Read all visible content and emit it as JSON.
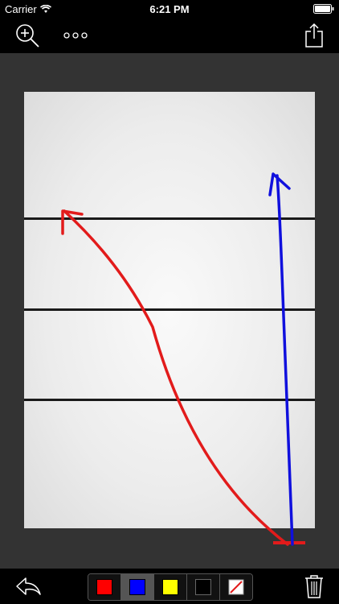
{
  "status": {
    "carrier": "Carrier",
    "time": "6:21 PM"
  },
  "toolbar": {
    "zoom_icon": "zoom-in-icon",
    "more_icon": "more-options-icon",
    "share_icon": "share-icon",
    "undo_icon": "undo-icon",
    "trash_icon": "trash-icon"
  },
  "palette": {
    "colors": [
      {
        "name": "red",
        "hex": "#ff0000"
      },
      {
        "name": "blue",
        "hex": "#0000ff"
      },
      {
        "name": "yellow",
        "hex": "#ffff00"
      },
      {
        "name": "black",
        "hex": "#000000"
      },
      {
        "name": "eraser",
        "hex": "#ffffff"
      }
    ],
    "selected": "blue"
  },
  "drawing": {
    "court_lines": 3,
    "strokes": [
      {
        "color": "#e21b1b",
        "kind": "curved-arrow"
      },
      {
        "color": "#1010dd",
        "kind": "straight-arrow"
      }
    ]
  }
}
